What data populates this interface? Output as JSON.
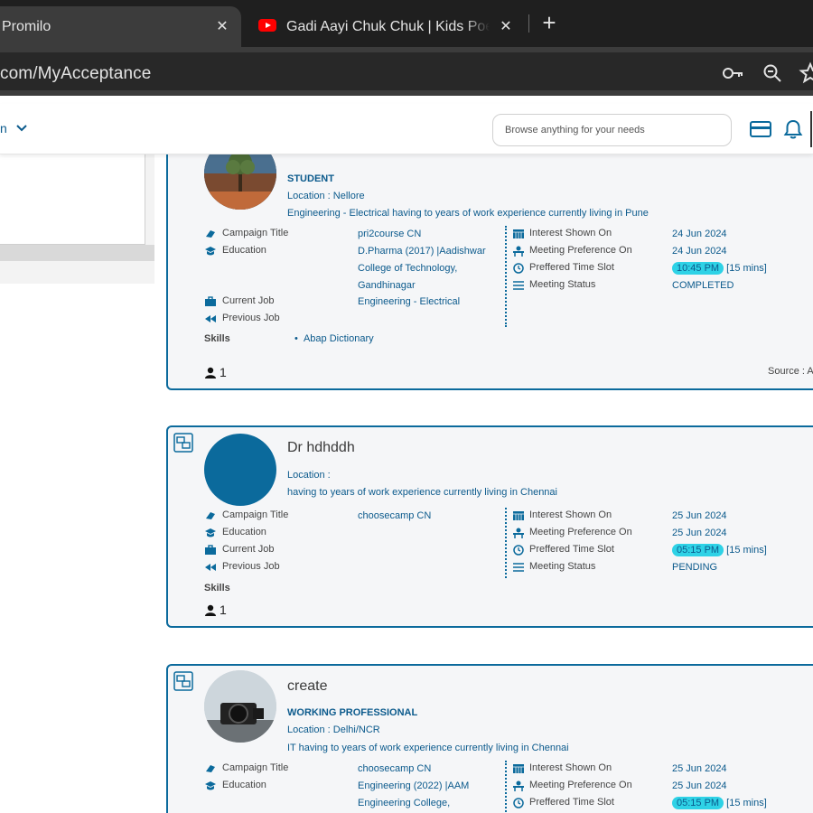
{
  "browser": {
    "tabs": [
      {
        "title": "Promilo",
        "close": "✕"
      },
      {
        "title": "Gadi Aayi Chuk Chuk | Kids Poem",
        "close": "✕"
      }
    ],
    "new_tab": "+",
    "url": "com/MyAcceptance",
    "icons": [
      "key-icon",
      "zoom-icon",
      "star-icon"
    ]
  },
  "header": {
    "nav_fragment": "n",
    "search_placeholder": "Browse anything for your needs",
    "icons": [
      "card-icon",
      "bell-icon"
    ]
  },
  "labels": {
    "campaign": "Campaign Title",
    "education": "Education",
    "current_job": "Current Job",
    "previous_job": "Previous Job",
    "interest": "Interest Shown On",
    "meeting_pref": "Meeting Preference On",
    "time_slot": "Preffered Time Slot",
    "meeting_status": "Meeting Status",
    "skills": "Skills"
  },
  "cards": [
    {
      "name": "",
      "role": "STUDENT",
      "location": "Location : Nellore",
      "summary": "Engineering - Electrical having to years of work experience currently living in Pune",
      "campaign": "pri2course CN",
      "education_lines": [
        "D.Pharma (2017) |Aadishwar",
        "College of Technology,",
        "Gandhinagar"
      ],
      "current_job": "Engineering - Electrical",
      "previous_job": "",
      "interest_on": "24 Jun 2024",
      "meeting_on": "24 Jun 2024",
      "time": "10:45 PM",
      "duration": "[15 mins]",
      "status": "COMPLETED",
      "skills": [
        "Abap Dictionary"
      ],
      "count": "1",
      "source_label": "Source : A"
    },
    {
      "name": "Dr hdhddh",
      "role": "",
      "location": "Location :",
      "summary": "having to years of work experience currently living in Chennai",
      "campaign": "choosecamp CN",
      "interest_on": "25 Jun 2024",
      "meeting_on": "25 Jun 2024",
      "time": "05:15 PM",
      "duration": "[15 mins]",
      "status": "PENDING",
      "count": "1"
    },
    {
      "name": "create",
      "role": "WORKING PROFESSIONAL",
      "location": "Location : Delhi/NCR",
      "summary": "IT having to years of work experience currently living in Chennai",
      "campaign": "choosecamp CN",
      "education_lines": [
        "Engineering (2022) |AAM",
        "Engineering College,"
      ],
      "interest_on": "25 Jun 2024",
      "meeting_on": "25 Jun 2024",
      "time": "05:15 PM",
      "duration": "[15 mins]"
    }
  ],
  "colors": {
    "accent": "#0b6a9c",
    "pill": "#2ed2e6",
    "link": "#0b5a8c"
  }
}
